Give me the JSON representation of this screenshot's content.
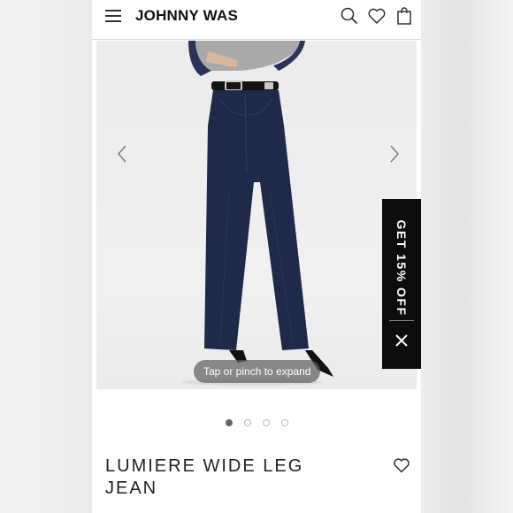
{
  "header": {
    "brand": "JOHNNY WAS",
    "icons": [
      "menu-icon",
      "search-icon",
      "heart-icon",
      "shopping-bag-icon"
    ]
  },
  "gallery": {
    "expand_hint": "Tap or pinch to expand",
    "slide_count": 4,
    "active_slide": 1,
    "icons": [
      "chevron-left-icon",
      "chevron-right-icon"
    ]
  },
  "product": {
    "title_line1": "LUMIERE WIDE LEG",
    "title_line2": "JEAN",
    "wishlist_icon": "heart-outline-icon"
  },
  "promo": {
    "label": "GET 15% OFF",
    "close_icon": "close-icon"
  },
  "colors": {
    "denim": "#1f2a4a",
    "promo_bg": "#0d0d0d",
    "text": "#1e1e1e"
  }
}
